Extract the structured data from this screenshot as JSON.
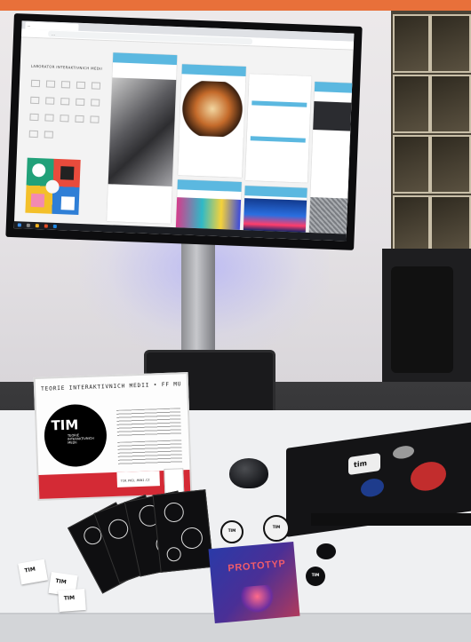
{
  "scene": {
    "description_colors": {
      "accent_orange": "#e8703a",
      "placard_red": "#d42a35",
      "site_blue": "#5bb8e0"
    }
  },
  "tv": {
    "browser": {
      "tab_title": "...",
      "url": "..."
    },
    "sidebar": {
      "title": "LABORATOR INTERAKTIVNICH MEDII",
      "tags": [
        "",
        "",
        "",
        "",
        "",
        "",
        "",
        "",
        "",
        "",
        "",
        "",
        "",
        "",
        "",
        "",
        ""
      ]
    },
    "cards": [
      {
        "heading": "",
        "caption": ""
      },
      {
        "heading": "",
        "caption": ""
      },
      {
        "heading": "",
        "caption": ""
      },
      {
        "heading": "",
        "caption": ""
      },
      {
        "heading": "",
        "caption": ""
      },
      {
        "heading": "",
        "caption": ""
      }
    ]
  },
  "placard": {
    "title": "TEORIE INTERAKTIVNICH MEDII • FF MU",
    "logo_text": "TIM",
    "logo_subtitle": "TEORIE INTERAKTIVNICH MEDII",
    "paragraph_1": "",
    "paragraph_2": "",
    "url": "TIM.PHIL.MUNI.CZ"
  },
  "zine": {
    "title": "PROTOTYP",
    "subtitle": ""
  },
  "badges": [
    {
      "text": "TIM"
    },
    {
      "text": "TIM"
    },
    {
      "text": "TIM"
    },
    {
      "text": ""
    }
  ],
  "stickers": [
    {
      "text": "TIM"
    },
    {
      "text": "TIM"
    },
    {
      "text": "TIM"
    }
  ],
  "laptop_stickers": [
    {
      "text": "tim"
    }
  ]
}
